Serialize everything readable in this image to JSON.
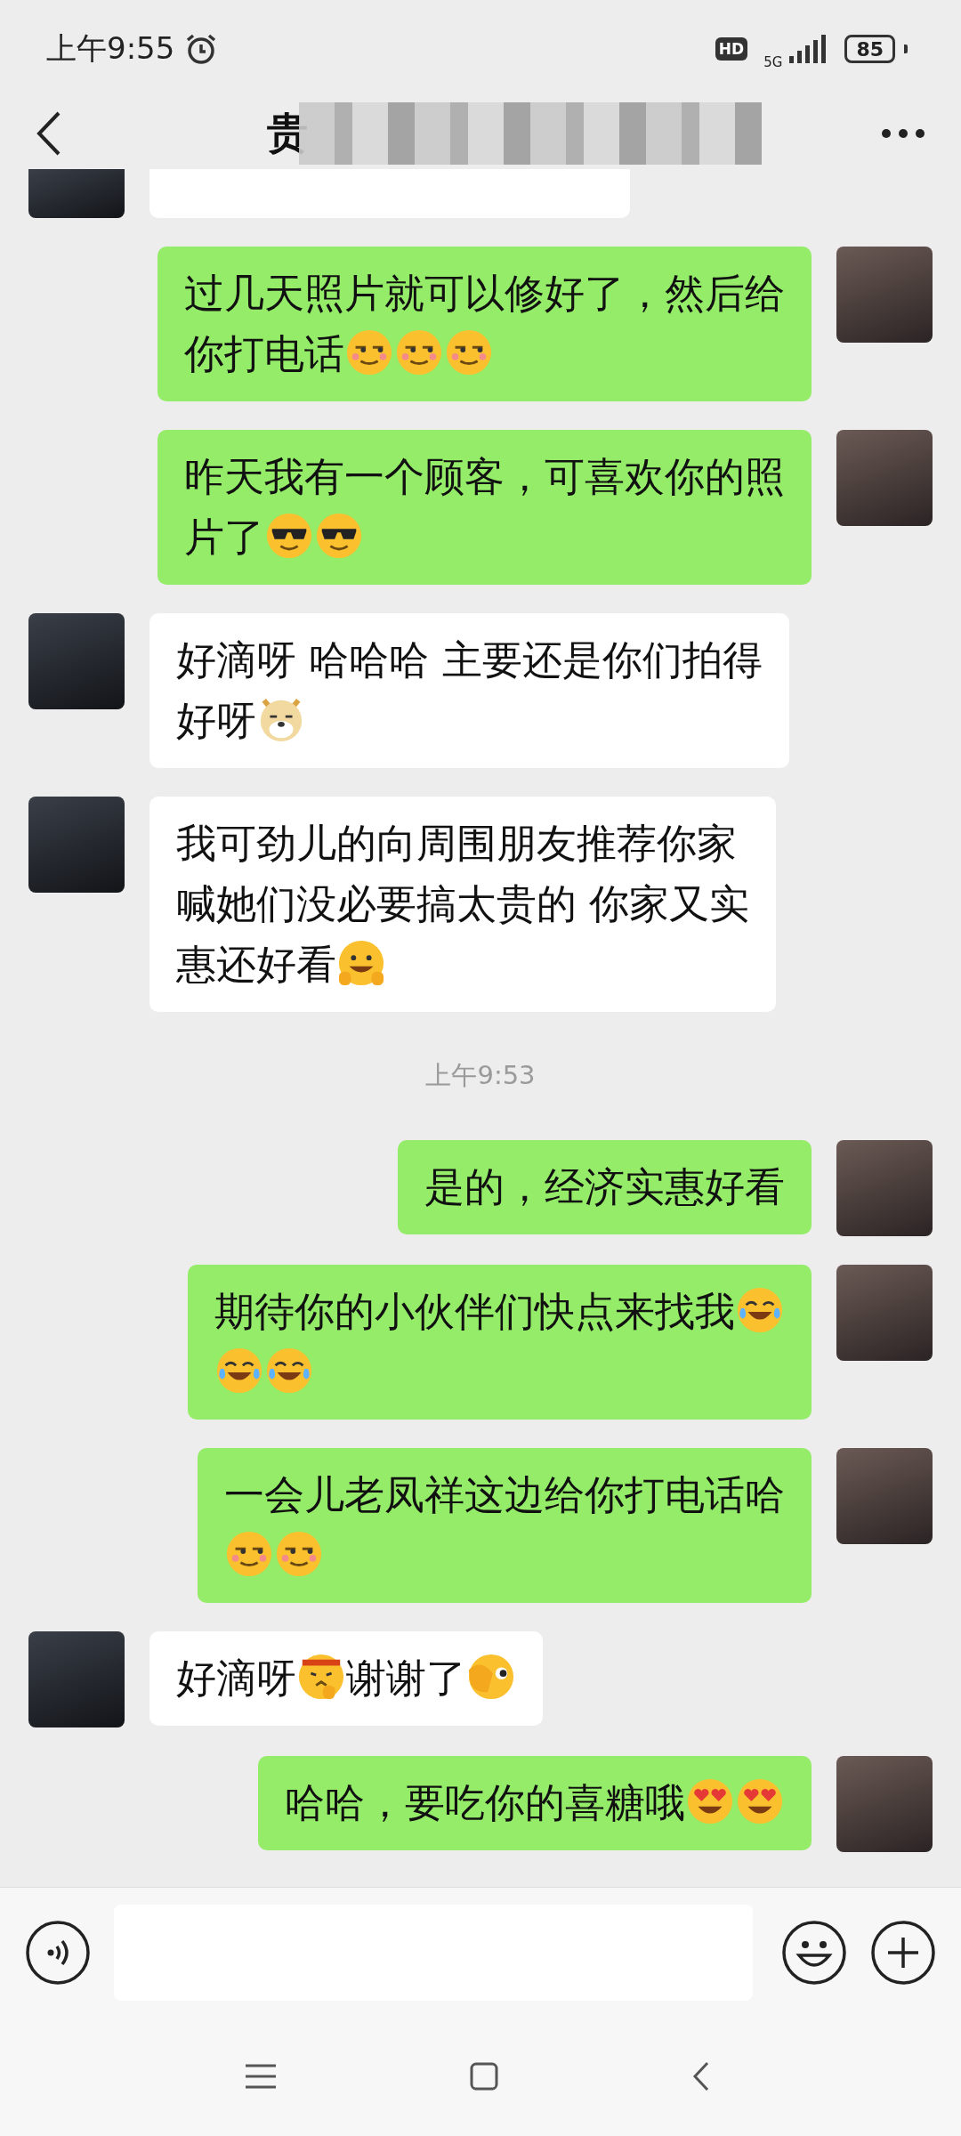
{
  "status_bar": {
    "time": "上午9:55",
    "hd_badge": "HD",
    "network": "5G",
    "battery": "85"
  },
  "header": {
    "title": "贵"
  },
  "messages": [
    {
      "kind": "cut_off"
    },
    {
      "kind": "outgoing",
      "parts": [
        {
          "kind": "text",
          "text": "过几天照片就可以修好了，然后给"
        },
        {
          "kind": "break"
        },
        {
          "kind": "text",
          "text": "你打电话"
        },
        {
          "kind": "sly"
        },
        {
          "kind": "sly"
        },
        {
          "kind": "sly"
        }
      ]
    },
    {
      "kind": "outgoing",
      "parts": [
        {
          "kind": "text",
          "text": "昨天我有一个顾客，可喜欢你的照"
        },
        {
          "kind": "break"
        },
        {
          "kind": "text",
          "text": "片了"
        },
        {
          "kind": "cool"
        },
        {
          "kind": "cool"
        }
      ]
    },
    {
      "kind": "incoming",
      "parts": [
        {
          "kind": "text",
          "text": "好滴呀 哈哈哈 主要还是你们拍得"
        },
        {
          "kind": "break"
        },
        {
          "kind": "text",
          "text": "好呀"
        },
        {
          "kind": "doge"
        }
      ]
    },
    {
      "kind": "incoming",
      "parts": [
        {
          "kind": "text",
          "text": "我可劲儿的向周围朋友推荐你家"
        },
        {
          "kind": "break"
        },
        {
          "kind": "text",
          "text": "喊她们没必要搞太贵的 你家又实"
        },
        {
          "kind": "break"
        },
        {
          "kind": "text",
          "text": "惠还好看"
        },
        {
          "kind": "grin"
        }
      ]
    },
    {
      "kind": "timestamp",
      "text": "上午9:53"
    },
    {
      "kind": "outgoing",
      "parts": [
        {
          "kind": "text",
          "text": "是的，经济实惠好看"
        }
      ]
    },
    {
      "kind": "outgoing",
      "parts": [
        {
          "kind": "text",
          "text": "期待你的小伙伴们快点来找我"
        },
        {
          "kind": "tears"
        },
        {
          "kind": "break"
        },
        {
          "kind": "tears"
        },
        {
          "kind": "tears"
        }
      ]
    },
    {
      "kind": "outgoing",
      "parts": [
        {
          "kind": "text",
          "text": "一会儿老凤祥这边给你打电话哈"
        },
        {
          "kind": "break"
        },
        {
          "kind": "sly"
        },
        {
          "kind": "sly"
        }
      ]
    },
    {
      "kind": "incoming",
      "parts": [
        {
          "kind": "text",
          "text": "好滴呀"
        },
        {
          "kind": "salute"
        },
        {
          "kind": "text",
          "text": "谢谢了"
        },
        {
          "kind": "peek"
        }
      ]
    },
    {
      "kind": "outgoing",
      "parts": [
        {
          "kind": "text",
          "text": "哈哈，要吃你的喜糖哦"
        },
        {
          "kind": "hearts"
        },
        {
          "kind": "hearts"
        }
      ]
    }
  ]
}
